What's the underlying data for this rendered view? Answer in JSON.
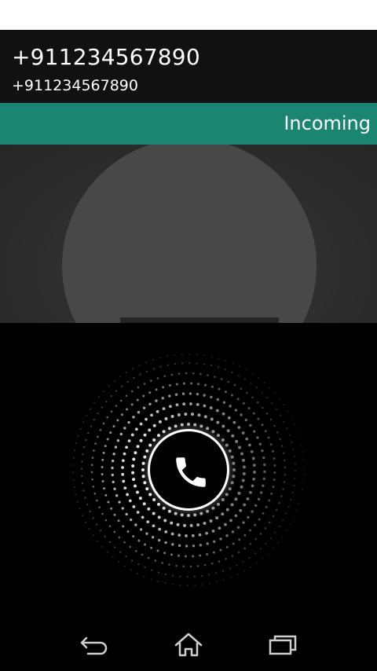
{
  "caller": {
    "name": "+911234567890",
    "number": "+911234567890"
  },
  "call_state": {
    "label": "Incoming"
  },
  "answer": {
    "icon": "phone-icon"
  },
  "nav": {
    "back_icon": "back-icon",
    "home_icon": "home-icon",
    "recents_icon": "recents-icon"
  },
  "colors": {
    "header_bg": "#111111",
    "incoming_bar": "#1a8570",
    "avatar": "#474847",
    "photo_bg": "#2c2c2c"
  }
}
